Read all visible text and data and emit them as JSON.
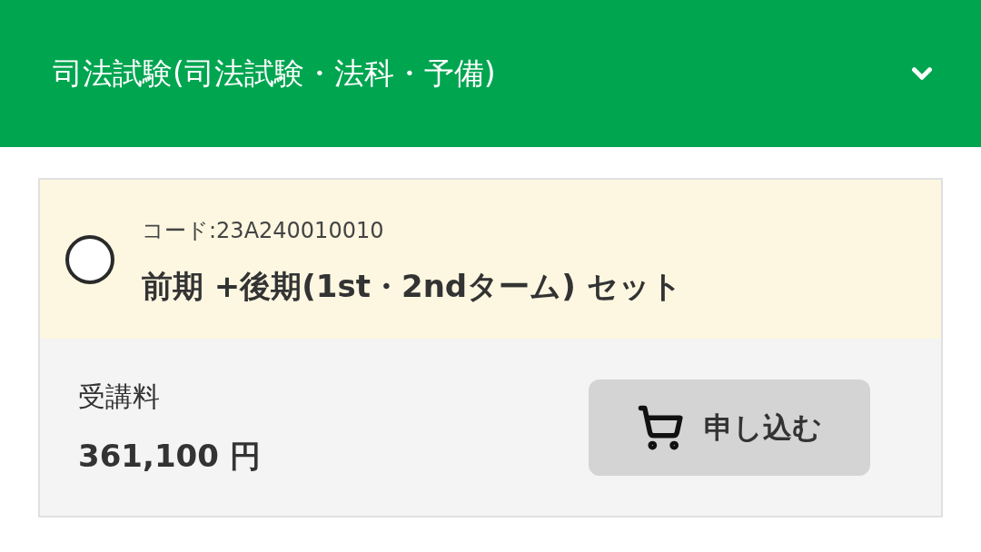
{
  "header": {
    "title": "司法試験(司法試験・法科・予備)"
  },
  "course": {
    "code": "コード:23A240010010",
    "title": "前期 +後期(1st・2ndターム) セット",
    "selected": false,
    "fee_label": "受講料",
    "fee": "361,100 円",
    "button": "申し込む"
  }
}
